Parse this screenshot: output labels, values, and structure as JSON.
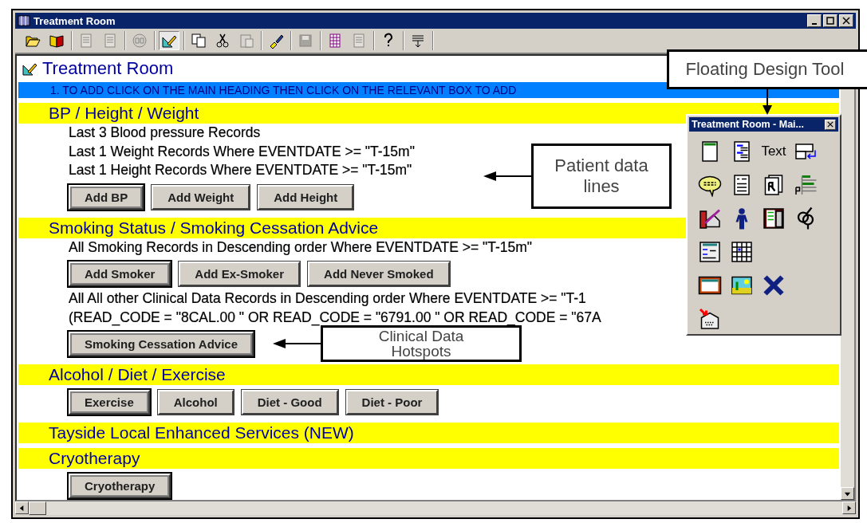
{
  "window": {
    "title": "Treatment Room"
  },
  "toolbar": [
    [
      {
        "disabled": false,
        "pressed": false
      },
      {
        "disabled": false,
        "pressed": false
      }
    ],
    [
      {
        "disabled": true,
        "pressed": false
      },
      {
        "disabled": true,
        "pressed": false
      }
    ],
    [
      {
        "disabled": true,
        "pressed": false
      }
    ],
    [
      {
        "disabled": false,
        "pressed": true
      }
    ],
    [
      {
        "disabled": false,
        "pressed": false
      },
      {
        "disabled": false,
        "pressed": false
      },
      {
        "disabled": true,
        "pressed": false
      }
    ],
    [
      {
        "disabled": false,
        "pressed": false
      }
    ],
    [
      {
        "disabled": true,
        "pressed": false
      }
    ],
    [
      {
        "disabled": false,
        "pressed": false
      },
      {
        "disabled": true,
        "pressed": false
      }
    ],
    [
      {
        "disabled": false,
        "pressed": false
      }
    ],
    [
      {
        "disabled": false,
        "pressed": false
      }
    ]
  ],
  "page_title": "Treatment Room",
  "instruction": "1. TO ADD CLICK ON THE MAIN HEADING  THEN CLICK ON THE RELEVANT BOX TO ADD",
  "sections": [
    {
      "heading": "BP / Height / Weight",
      "blocks": [
        {
          "kind": "lines",
          "lines": [
            "Last 3 Blood pressure Records",
            "Last 1 Weight Records Where EVENTDATE >= \"T-15m\"",
            "Last 1 Height Records Where EVENTDATE >= \"T-15m\""
          ]
        },
        {
          "kind": "buttons",
          "buttons": [
            {
              "label": "Add BP",
              "framed": true
            },
            {
              "label": "Add Weight",
              "framed": false
            },
            {
              "label": "Add Height",
              "framed": false
            }
          ]
        }
      ]
    },
    {
      "heading": "Smoking Status / Smoking Cessation Advice",
      "blocks": [
        {
          "kind": "lines",
          "lines": [
            "All Smoking Records in Descending order Where EVENTDATE >= \"T-15m\""
          ]
        },
        {
          "kind": "buttons",
          "buttons": [
            {
              "label": "Add Smoker",
              "framed": true
            },
            {
              "label": "Add Ex-Smoker",
              "framed": false
            },
            {
              "label": "Add Never Smoked",
              "framed": false
            }
          ]
        },
        {
          "kind": "lines",
          "lines": [
            "All All other Clinical Data Records in Descending order Where EVENTDATE >= \"T-1",
            "(READ_CODE = \"8CAL.00 \" OR READ_CODE = \"6791.00 \" OR READ_CODE = \"67A"
          ]
        },
        {
          "kind": "buttons",
          "buttons": [
            {
              "label": "Smoking Cessation Advice",
              "framed": true
            }
          ]
        }
      ]
    },
    {
      "heading": "Alcohol / Diet / Exercise",
      "blocks": [
        {
          "kind": "buttons",
          "buttons": [
            {
              "label": "Exercise",
              "framed": true
            },
            {
              "label": "Alcohol",
              "framed": false
            },
            {
              "label": "Diet - Good",
              "framed": false
            },
            {
              "label": "Diet - Poor",
              "framed": false
            }
          ]
        }
      ]
    },
    {
      "heading": "Tayside Local Enhanced Services (NEW)"
    },
    {
      "heading": "Cryotherapy",
      "blocks": [
        {
          "kind": "buttons",
          "buttons": [
            {
              "label": "Cryotherapy",
              "framed": true
            }
          ]
        }
      ]
    }
  ],
  "palette": {
    "title": "Treatment Room - Mai...",
    "text_tool": "Text"
  },
  "callouts": [
    {
      "kind": "down",
      "text": "Floating Design Tool"
    },
    {
      "kind": "left",
      "text": "Patient data lines"
    },
    {
      "kind": "left",
      "text": "Clinical Data Hotspots"
    }
  ]
}
